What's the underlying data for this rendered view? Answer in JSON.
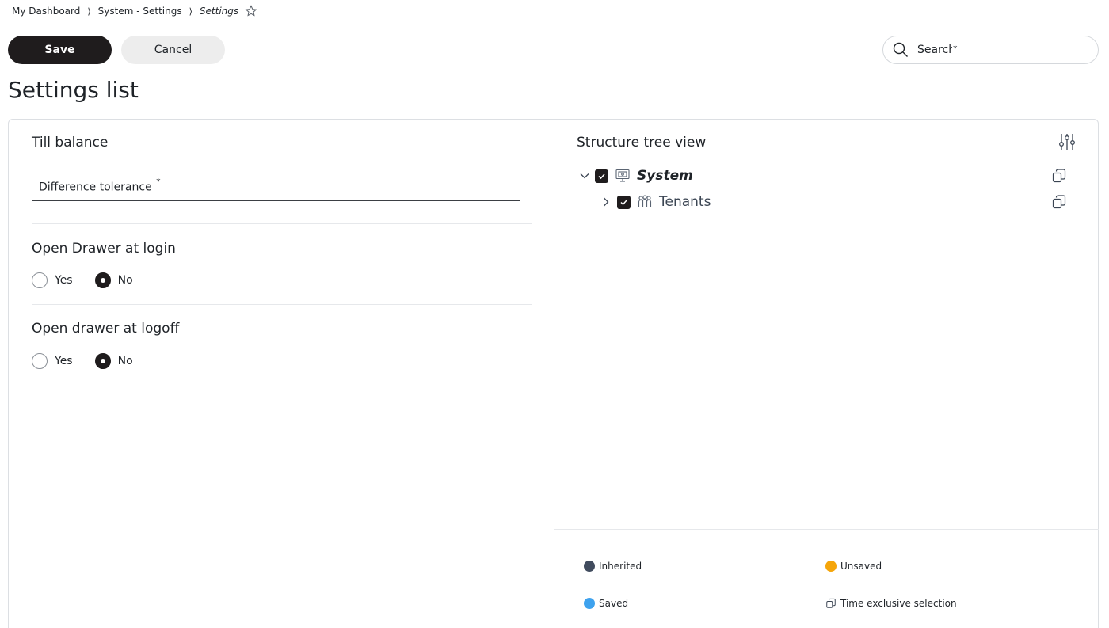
{
  "breadcrumb": {
    "items": [
      "My Dashboard",
      "System - Settings",
      "Settings"
    ],
    "separator": "⟩"
  },
  "toolbar": {
    "save_label": "Save",
    "cancel_label": "Cancel"
  },
  "search": {
    "placeholder": "Search",
    "required_marker": "*"
  },
  "page_title": "Settings list",
  "settings": {
    "till_balance": {
      "title": "Till balance",
      "field_label": "Difference tolerance",
      "required_marker": "*"
    },
    "open_drawer_login": {
      "title": "Open Drawer at login",
      "options": [
        "Yes",
        "No"
      ],
      "selected": "No"
    },
    "open_drawer_logoff": {
      "title": "Open drawer at logoff",
      "options": [
        "Yes",
        "No"
      ],
      "selected": "No"
    }
  },
  "tree": {
    "title": "Structure tree view",
    "nodes": [
      {
        "label": "System",
        "expanded": true,
        "checked": true,
        "icon": "monitor-icon"
      },
      {
        "label": "Tenants",
        "expanded": false,
        "checked": true,
        "icon": "people-icon"
      }
    ]
  },
  "legend": {
    "inherited": {
      "label": "Inherited",
      "color": "#414c5e"
    },
    "unsaved": {
      "label": "Unsaved",
      "color": "#f5a50a"
    },
    "saved": {
      "label": "Saved",
      "color": "#3ea2ee"
    },
    "time_exclusive": {
      "label": "Time exclusive selection",
      "icon": "copy-icon"
    }
  }
}
